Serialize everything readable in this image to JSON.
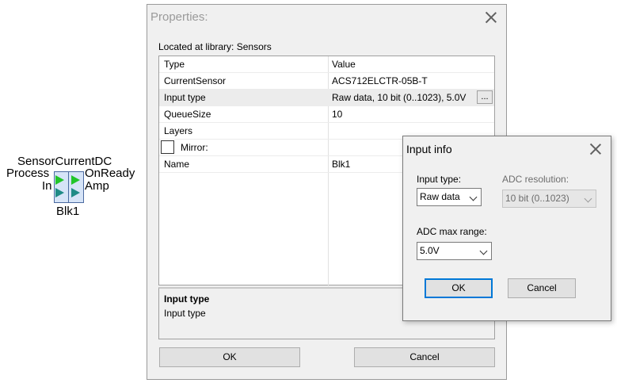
{
  "component": {
    "title": "SensorCurrentDC",
    "left_top": "Process",
    "left_bottom": "In",
    "right_top": "OnReady",
    "right_bottom": "Amp",
    "name": "Blk1",
    "pin_colors": {
      "active": "#22c52a",
      "passive": "#1f8b86"
    }
  },
  "properties_dialog": {
    "title": "Properties:",
    "library_label": "Located at library: Sensors",
    "grid_header": {
      "name": "Type",
      "value": "Value"
    },
    "rows": [
      {
        "name": "CurrentSensor",
        "value": "ACS712ELCTR-05B-T"
      },
      {
        "name": "Input type",
        "value": "Raw data, 10 bit (0..1023), 5.0V",
        "button": "..."
      },
      {
        "name": "QueueSize",
        "value": "10"
      },
      {
        "name": "Layers",
        "value": ""
      },
      {
        "name": "Mirror:",
        "value": ""
      },
      {
        "name": "Name",
        "value": "Blk1"
      }
    ],
    "description": {
      "title": "Input type",
      "text": "Input type"
    },
    "ok_label": "OK",
    "cancel_label": "Cancel"
  },
  "input_info_dialog": {
    "title": "Input info",
    "input_type_label": "Input type:",
    "input_type_value": "Raw data",
    "adc_resolution_label": "ADC resolution:",
    "adc_resolution_value": "10 bit (0..1023)",
    "adc_max_range_label": "ADC max range:",
    "adc_max_range_value": "5.0V",
    "ok_label": "OK",
    "cancel_label": "Cancel"
  }
}
